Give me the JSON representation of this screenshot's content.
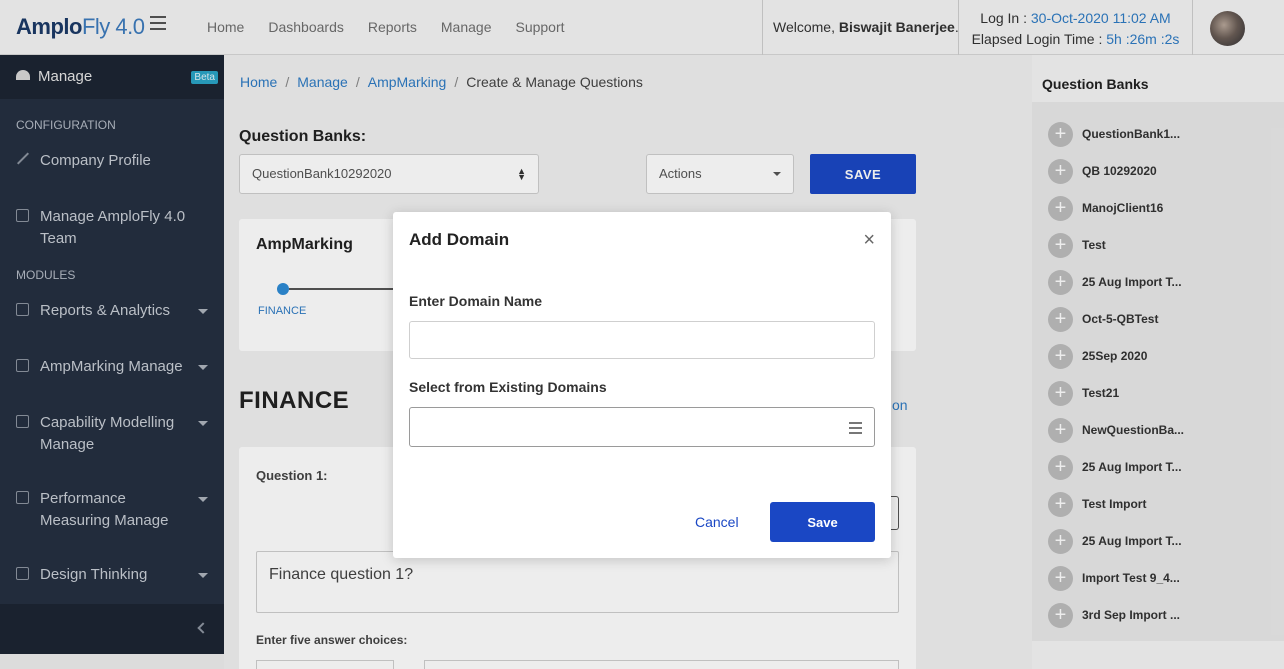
{
  "header": {
    "logo_main": "Amplo",
    "logo_sub": "Fly 4.0",
    "nav": [
      "Home",
      "Dashboards",
      "Reports",
      "Manage",
      "Support"
    ],
    "welcome_prefix": "Welcome, ",
    "user_name": "Biswajit Banerjee",
    "welcome_suffix": ".",
    "login_label": "Log In : ",
    "login_value": "30-Oct-2020 11:02 AM",
    "elapsed_label": "Elapsed Login Time : ",
    "elapsed_value": "5h :26m :2s"
  },
  "sidebar": {
    "title": "Manage",
    "badge": "Beta",
    "section_config": "CONFIGURATION",
    "section_modules": "MODULES",
    "items": [
      {
        "label": "Company Profile"
      },
      {
        "label": "Manage AmploFly 4.0 Team"
      },
      {
        "label": "Reports & Analytics"
      },
      {
        "label": "AmpMarking Manage"
      },
      {
        "label": "Capability Modelling Manage"
      },
      {
        "label": "Performance Measuring Manage"
      },
      {
        "label": "Design Thinking"
      }
    ]
  },
  "breadcrumb": [
    "Home",
    "Manage",
    "AmpMarking",
    "Create & Manage Questions"
  ],
  "main": {
    "qb_title": "Question Banks:",
    "qb_selected": "QuestionBank10292020",
    "actions_label": "Actions",
    "save_label": "SAVE",
    "card_title": "AmpMarking",
    "step_label": "FINANCE",
    "section_title": "FINANCE",
    "side_link_fragment": "on",
    "question_label": "Question 1:",
    "question_text": "Finance question 1?",
    "answers_label": "Enter five answer choices:"
  },
  "right_panel": {
    "title": "Question Banks",
    "items": [
      "QuestionBank1...",
      "QB 10292020",
      "ManojClient16",
      "Test",
      "25 Aug Import T...",
      "Oct-5-QBTest",
      "25Sep 2020",
      "Test21",
      "NewQuestionBa...",
      "25 Aug Import T...",
      "Test Import",
      "25 Aug Import T...",
      "Import Test 9_4...",
      "3rd Sep Import ..."
    ]
  },
  "modal": {
    "title": "Add Domain",
    "close_glyph": "×",
    "domain_name_label": "Enter Domain Name",
    "domain_name_value": "",
    "existing_label": "Select from Existing Domains",
    "existing_value": "",
    "cancel_label": "Cancel",
    "save_label": "Save"
  }
}
